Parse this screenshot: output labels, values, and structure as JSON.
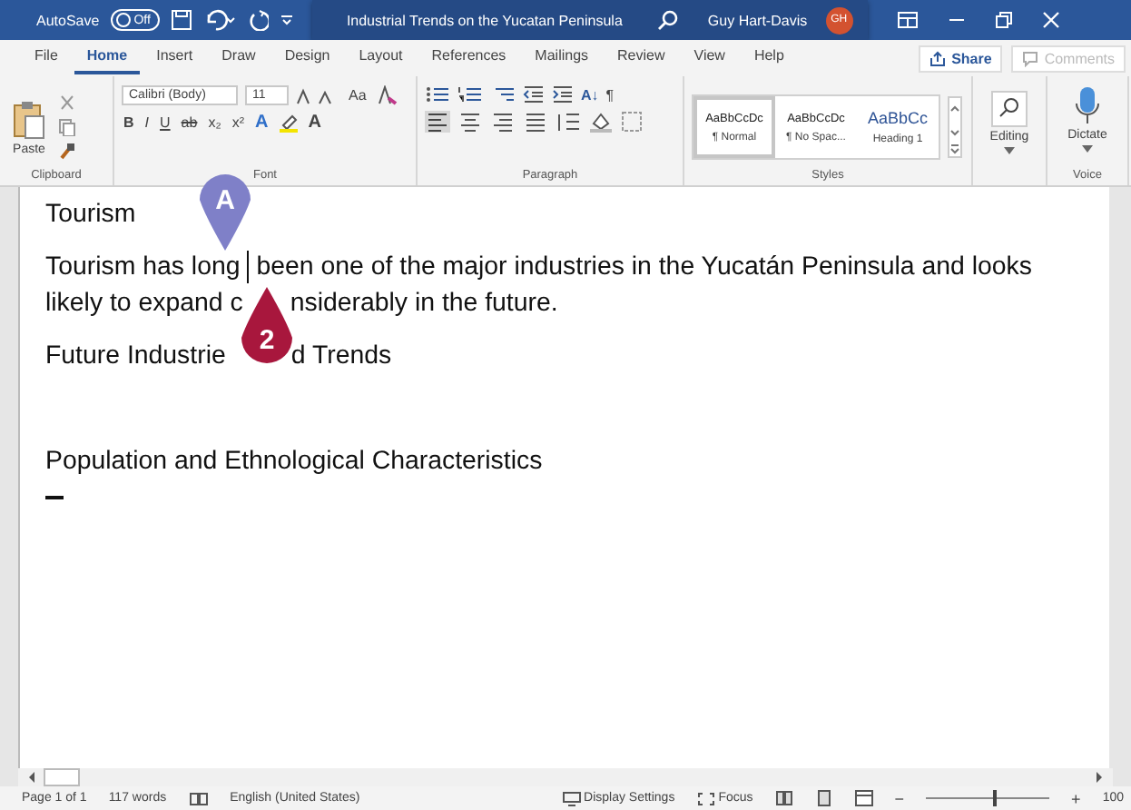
{
  "title_bar": {
    "autosave_label": "AutoSave",
    "autosave_toggle": {
      "label": "Off",
      "on": false
    },
    "title": "Industrial Trends on the Yucatan Peninsula",
    "user_name": "Guy Hart-Davis",
    "user_initials": "GH"
  },
  "tabs": [
    {
      "label": "File",
      "selected": false
    },
    {
      "label": "Home",
      "selected": true
    },
    {
      "label": "Insert",
      "selected": false
    },
    {
      "label": "Draw",
      "selected": false
    },
    {
      "label": "Design",
      "selected": false
    },
    {
      "label": "Layout",
      "selected": false
    },
    {
      "label": "References",
      "selected": false
    },
    {
      "label": "Mailings",
      "selected": false
    },
    {
      "label": "Review",
      "selected": false
    },
    {
      "label": "View",
      "selected": false
    },
    {
      "label": "Help",
      "selected": false
    }
  ],
  "share_button": {
    "label": "Share"
  },
  "comments_button": {
    "label": "Comments",
    "disabled": true
  },
  "ribbon": {
    "clipboard": {
      "label": "Clipboard",
      "paste": "Paste"
    },
    "font": {
      "label": "Font",
      "font_name": "Calibri (Body)",
      "font_size": "11",
      "change_case": "Aa",
      "format_buttons": [
        "B",
        "I",
        "U",
        "ab",
        "x₂",
        "x²"
      ],
      "color_buttons": [
        {
          "label": "A",
          "color": "#2f6fc9"
        },
        {
          "label": "A",
          "color": "#444444"
        }
      ]
    },
    "paragraph": {
      "label": "Paragraph",
      "sort": "A↓",
      "pilcrow": "¶"
    },
    "styles": {
      "label": "Styles",
      "items": [
        {
          "preview": "AaBbCcDc",
          "name": "¶ Normal",
          "selected": true
        },
        {
          "preview": "AaBbCcDc",
          "name": "¶ No Spac...",
          "selected": false
        },
        {
          "preview": "AaBbCc",
          "name": "Heading 1",
          "selected": false
        }
      ]
    },
    "editing": {
      "label": "Editing"
    },
    "voice": {
      "label": "Voice",
      "dictate": "Dictate"
    }
  },
  "document": {
    "blocks": [
      {
        "kind": "heading",
        "lines": [
          [
            "Tourism"
          ]
        ]
      },
      {
        "kind": "body",
        "lines": [
          [
            "Tourism has long",
            "been one of the major industries in the Yucatán Peninsula and looks"
          ],
          [
            "likely to expand c",
            "nsiderably in the future."
          ]
        ]
      },
      {
        "kind": "heading",
        "lines": [
          [
            "Future Industrie",
            "d Trends"
          ]
        ]
      },
      {
        "kind": "empty"
      },
      {
        "kind": "heading",
        "lines": [
          [
            "Population and Ethnological Characteristics"
          ]
        ]
      },
      {
        "kind": "mark"
      }
    ]
  },
  "callouts": [
    {
      "label": "A",
      "color": "#7f80c8",
      "kind": "down"
    },
    {
      "label": "2",
      "color": "#a8173d",
      "kind": "up"
    }
  ],
  "status_bar": {
    "page": "Page 1 of 1",
    "words": "117 words",
    "language": "English (United States)",
    "display_settings": "Display Settings",
    "focus": "Focus",
    "zoom": {
      "out": "−",
      "in": "+",
      "level": 0.55,
      "label": "100"
    }
  }
}
